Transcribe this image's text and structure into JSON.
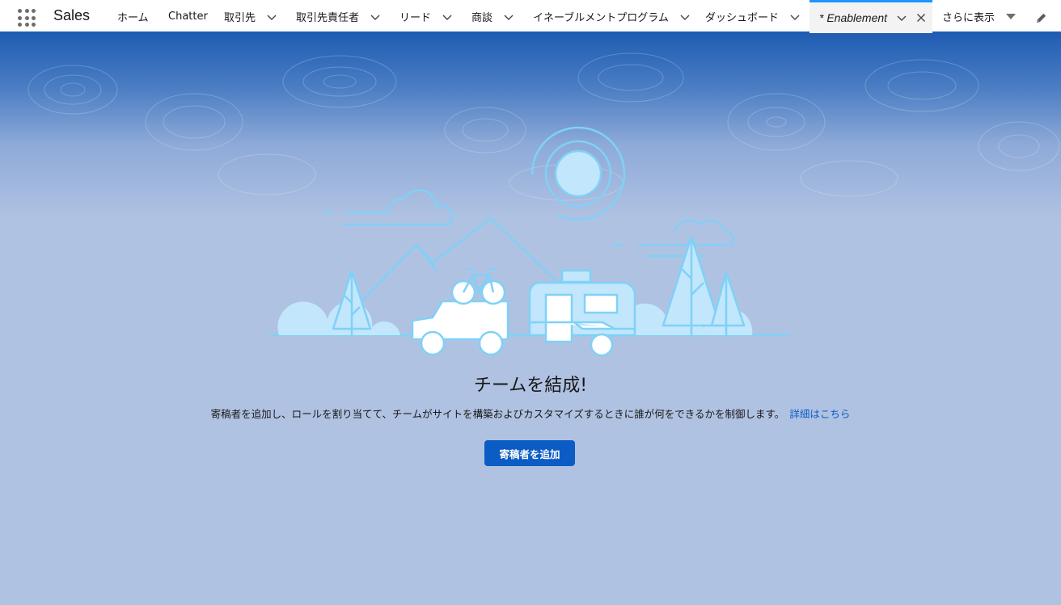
{
  "app": {
    "name": "Sales"
  },
  "nav": {
    "tabs": [
      {
        "label": "ホーム"
      },
      {
        "label": "Chatter"
      },
      {
        "label": "取引先"
      },
      {
        "label": "取引先責任者"
      },
      {
        "label": "リード"
      },
      {
        "label": "商談"
      },
      {
        "label": "イネーブルメントプログラム"
      },
      {
        "label": "ダッシュボード"
      }
    ],
    "active_tab": {
      "label": "* Enablement"
    },
    "more_label": "さらに表示"
  },
  "empty_state": {
    "title": "チームを結成!",
    "description": "寄稿者を追加し、ロールを割り当てて、チームがサイトを構築およびカスタマイズするときに誰が何をできるかを制御します。",
    "learn_more": "詳細はこちら",
    "button": "寄稿者を追加"
  },
  "colors": {
    "brand": "#0b5cc4",
    "active_tab_bar": "#1b96ff",
    "background": "#b0c2e2",
    "illustration_fill": "#c2e6fb",
    "illustration_stroke": "#7fd1f7"
  },
  "icons": [
    "app-launcher-icon",
    "chevron-down-icon",
    "close-icon",
    "caret-down-icon",
    "pencil-icon"
  ]
}
